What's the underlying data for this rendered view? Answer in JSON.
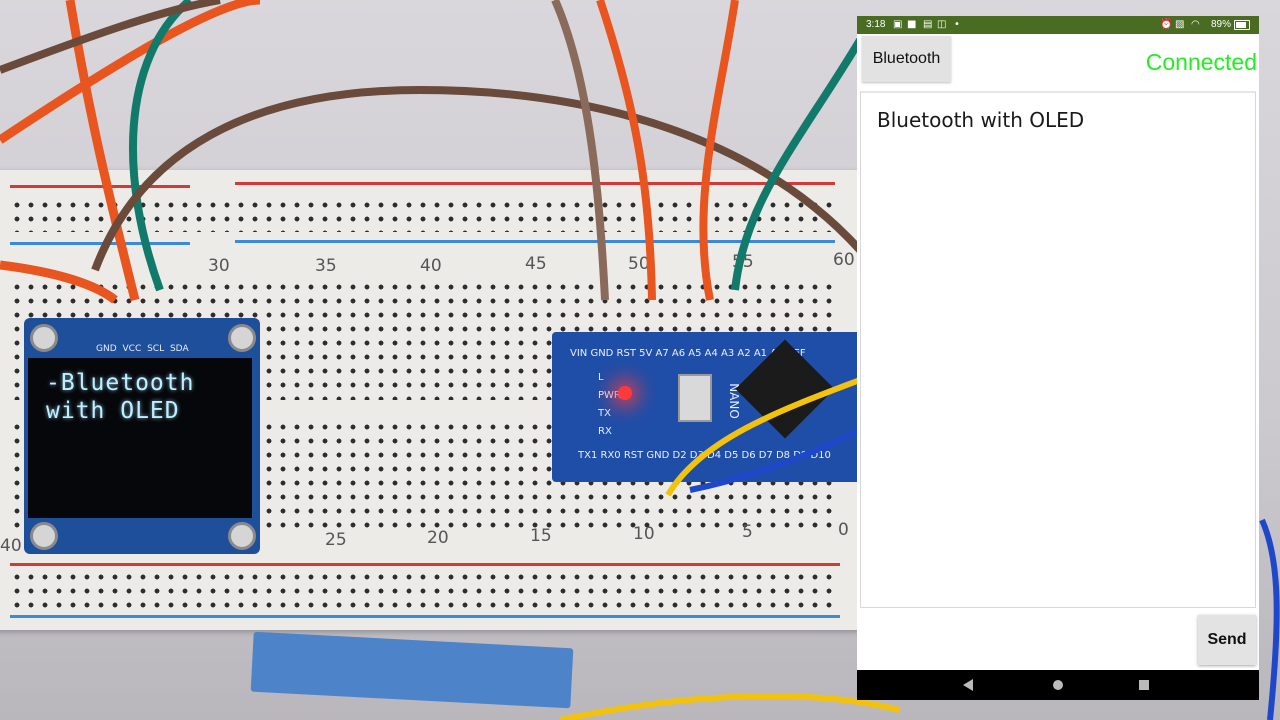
{
  "photo": {
    "oled_lines": [
      "-Bluetooth",
      "with OLED"
    ],
    "oled_pin_labels": "GND VCC SCL SDA",
    "nano_top_labels": "VIN GND RST 5V A7 A6 A5 A4 A3 A2 A1 A0 REF",
    "nano_bottom_labels": "TX1 RX0 RST GND D2 D3 D4 D5 D6 D7 D8 D9 D10",
    "nano_side_labels": [
      "L",
      "PWR",
      "TX",
      "RX"
    ],
    "nano_brand": "NANO",
    "breadboard_numbers_top": [
      "30",
      "35",
      "40",
      "45",
      "50",
      "55",
      "60"
    ],
    "breadboard_numbers_bottom": [
      "40",
      "25",
      "20",
      "15",
      "10",
      "5",
      "0"
    ],
    "colors": {
      "wire_orange": "#e8551e",
      "wire_teal": "#127a6a",
      "wire_brown": "#6a4a3a",
      "wire_yellow": "#f2c20c",
      "wire_blue": "#1f47c9"
    }
  },
  "phone": {
    "status_bar": {
      "time": "3:18",
      "icons": [
        "image-icon",
        "video-icon",
        "nfc-icon",
        "cast-icon",
        "dot-icon",
        "alarm-icon",
        "sim-icon",
        "wifi-icon"
      ],
      "battery": "89%",
      "color": "#4a6b22"
    },
    "bluetooth_button_label": "Bluetooth",
    "connection_status": "Connected",
    "connection_color": "#22ee22",
    "message_text": "Bluetooth with OLED",
    "send_input_value": "",
    "send_button_label": "Send",
    "nav": {
      "back": "back-icon",
      "home": "home-icon",
      "recent": "recent-apps-icon"
    }
  }
}
